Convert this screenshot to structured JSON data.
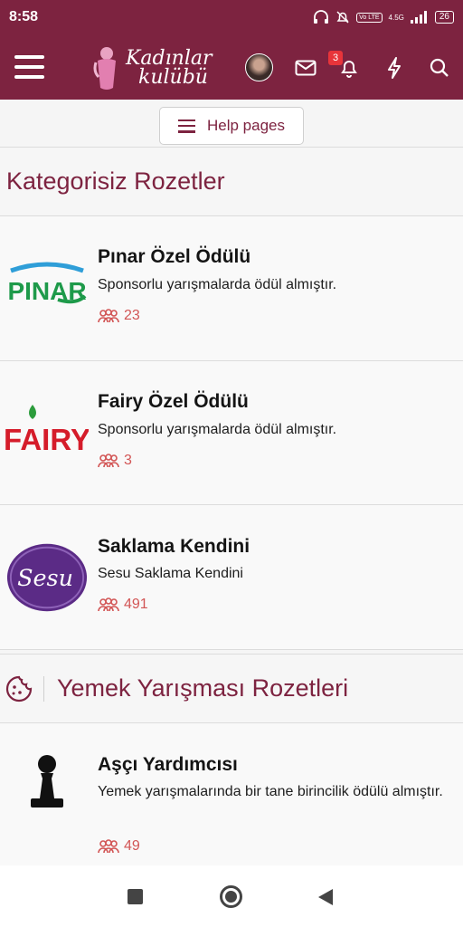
{
  "status_bar": {
    "time": "8:58",
    "network": "4.5G",
    "volte": "Vo LTE",
    "battery": "26"
  },
  "header": {
    "logo_line1": "Kadınlar",
    "logo_line2": "kulübü",
    "notification_count": "3"
  },
  "help_button": {
    "label": "Help pages"
  },
  "sections": [
    {
      "title": "Kategorisiz Rozetler",
      "items": [
        {
          "title": "Pınar Özel Ödülü",
          "description": "Sponsorlu yarışmalarda ödül almıştır.",
          "count": "23",
          "logo_text": "PINAR"
        },
        {
          "title": "Fairy Özel Ödülü",
          "description": "Sponsorlu yarışmalarda ödül almıştır.",
          "count": "3",
          "logo_text": "FAIRY"
        },
        {
          "title": "Saklama Kendini",
          "description": "Sesu Saklama Kendini",
          "count": "491",
          "logo_text": "Sesu"
        }
      ]
    },
    {
      "title": "Yemek Yarışması Rozetleri",
      "items": [
        {
          "title": "Aşçı Yardımcısı",
          "description": "Yemek yarışmalarında bir tane birincilik ödülü almıştır.",
          "count": "49"
        }
      ]
    }
  ],
  "colors": {
    "brand": "#7d2340",
    "count": "#d25555",
    "badge": "#e8343a"
  }
}
